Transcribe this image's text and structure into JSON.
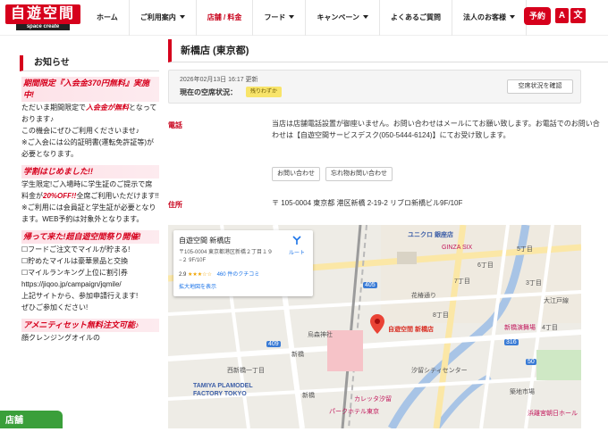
{
  "header": {
    "logo_text": "自遊空間",
    "logo_sub": "space create",
    "nav": [
      {
        "label": "ホーム",
        "caret": false,
        "active": false
      },
      {
        "label": "ご利用案内",
        "caret": true,
        "active": false
      },
      {
        "label": "店舗 / 料金",
        "caret": false,
        "active": true
      },
      {
        "label": "フード",
        "caret": true,
        "active": false
      },
      {
        "label": "キャンペーン",
        "caret": true,
        "active": false
      },
      {
        "label": "よくあるご質問",
        "caret": false,
        "active": false
      },
      {
        "label": "法人のお客様",
        "caret": true,
        "active": false
      }
    ],
    "reserve_label": "予約",
    "lang_a": "A",
    "lang_b": "文"
  },
  "sidebar": {
    "title": "お知らせ",
    "promo1_head": "期間限定『入会金370円無料』実施中!",
    "promo1_text_a": "ただいま期間限定で",
    "promo1_text_red": "入会金が無料",
    "promo1_text_b": "となっております♪",
    "promo1_line2": "この機会にぜひご利用くださいませ♪",
    "promo1_line3": "※ご入会には公的証明書(運転免許証等)が必要となります。",
    "promo2_head": "学割はじめました!!",
    "promo2_text_a": "学生限定!ご入場時に学生証のご提示で席料金が",
    "promo2_text_red": "20%OFF!!",
    "promo2_text_b": "全席ご利用いただけます!!",
    "promo2_line2": "※ご利用には会員証と学生証が必要となります。WEB予約は対象外となります。",
    "promo3_head": "帰って来た!超自遊空間祭り開催!",
    "promo3_lines": [
      "☐フードご注文でマイルが貯まる!",
      "☐貯めたマイルは豪華景品と交換",
      "☐マイルランキング上位に割引券",
      "https://jiqoo.jp/campaign/jqmile/",
      "上記サイトから、参加申請行えます!",
      "ぜひご参加ください!"
    ],
    "promo4_head": "アメニティセット無料注文可能♪",
    "promo4_text": "顔クレンジングオイルの",
    "chat_label": "店舗"
  },
  "main": {
    "store_title": "新橋店 (東京都)",
    "status_date": "2026年02月13日 16:17 更新",
    "status_label": "現在の空席状況：",
    "status_badge": "残りわずか",
    "check_button": "空席状況を確認",
    "phone_label": "電話",
    "phone_text": "当店は店舗電話設置が御座いません。お問い合わせはメールにてお願い致します。お電話でのお問い合わせは【自遊空間サービスデスク(050-5444-6124)】にてお受け致します。",
    "inquiry_button": "お問い合わせ",
    "lost_button": "忘れ物お問い合わせ",
    "address_label": "住所",
    "address_text": "〒 105-0004 東京都 港区新橋 2-19-2 リブロ新橋ビル9F/10F"
  },
  "map": {
    "card_title": "自遊空間 新橋店",
    "card_addr": "〒105-0004 東京都港区新橋２丁目１９−２ 9F/10F",
    "card_rating": "2.9",
    "card_stars": "★★★☆☆",
    "card_reviews": "460 件のクチコミ",
    "card_link": "拡大地図を表示",
    "card_route": "ルート",
    "labels": {
      "uniqlo": "ユニクロ 銀座店",
      "ginza_six": "GINZA SIX",
      "chome5": "5丁目",
      "chome6": "6丁目",
      "chome7": "7丁目",
      "chome8": "8丁目",
      "chome3": "3丁目",
      "chome4": "4丁目",
      "kaori": "花椿通り",
      "shinbashi_theater": "新橋演舞場",
      "shinbashi_station": "新橋",
      "karasumori": "烏森神社",
      "store_pin": "自遊空間 新橋店",
      "shiodome": "汐留シティセンター",
      "nishi_shinbashi": "西新橋一丁目",
      "tamiya": "TAMIYA PLAMODEL FACTORY TOKYO",
      "shinbashi_bottom": "新橋",
      "kaigan": "カレッタ汐留",
      "park_hotel": "パークホテル東京",
      "tsukiji": "築地市場",
      "hamarikyu": "浜離宮朝日ホール",
      "odeon": "大江戸線",
      "road_405": "405",
      "road_316": "316",
      "road_409": "409",
      "road_50": "50"
    }
  }
}
